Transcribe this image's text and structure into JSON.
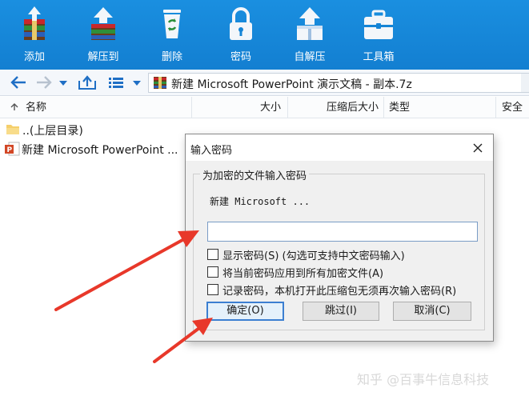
{
  "toolbar": {
    "buttons": [
      {
        "label": "添加",
        "icon": "add-archive-icon"
      },
      {
        "label": "解压到",
        "icon": "extract-to-icon"
      },
      {
        "label": "删除",
        "icon": "delete-recycle-icon"
      },
      {
        "label": "密码",
        "icon": "password-lock-icon"
      },
      {
        "label": "自解压",
        "icon": "self-extract-icon"
      },
      {
        "label": "工具箱",
        "icon": "toolbox-icon"
      }
    ]
  },
  "address_bar": {
    "path": "新建 Microsoft PowerPoint 演示文稿 - 副本.7z"
  },
  "columns": {
    "name": "名称",
    "size": "大小",
    "packed": "压缩后大小",
    "type": "类型",
    "security": "安全"
  },
  "files": [
    {
      "name": "..(上层目录)",
      "icon": "folder-icon"
    },
    {
      "name": "新建 Microsoft PowerPoint ...",
      "icon": "powerpoint-file-icon"
    }
  ],
  "dialog": {
    "title": "输入密码",
    "group_label": "为加密的文件输入密码",
    "file_name": "新建 Microsoft ...",
    "password_value": "",
    "options": [
      {
        "label": "显示密码(S) (勾选可支持中文密码输入)",
        "checked": false
      },
      {
        "label": "将当前密码应用到所有加密文件(A)",
        "checked": false
      },
      {
        "label": "记录密码，本机打开此压缩包无须再次输入密码(R)",
        "checked": false
      }
    ],
    "buttons": {
      "ok": "确定(O)",
      "skip": "跳过(I)",
      "cancel": "取消(C)"
    }
  },
  "watermark": "知乎 @百事牛信息科技",
  "colors": {
    "toolbar_blue": "#1584d6",
    "annotation_red": "#e8382a",
    "focus_blue": "#3c7fd1"
  }
}
